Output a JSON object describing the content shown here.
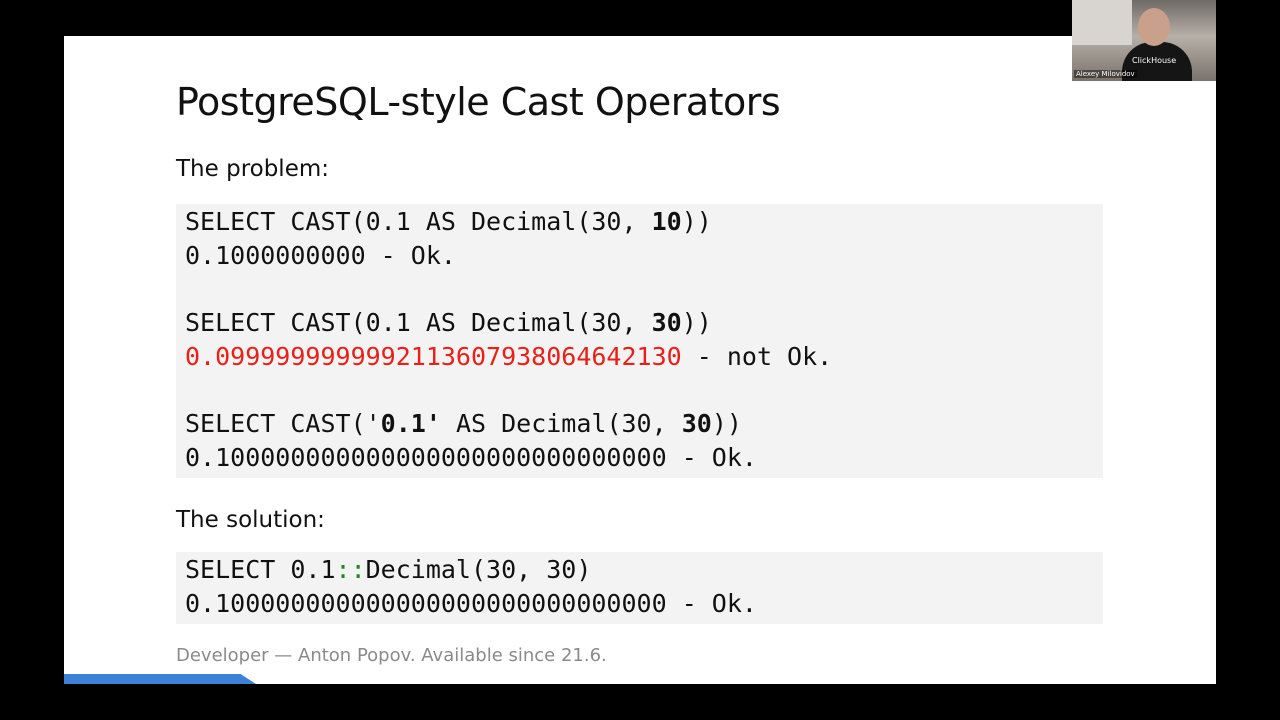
{
  "slide": {
    "title": "PostgreSQL-style Cast Operators",
    "problem_label": "The problem:",
    "solution_label": "The solution:",
    "footer": "Developer — Anton Popov. Available since 21.6."
  },
  "problem_code": [
    {
      "pre": "SELECT CAST(0.1 AS Decimal(30, ",
      "bold": "10",
      "post": "))"
    },
    {
      "text": "0.1000000000 - Ok."
    },
    {
      "text": ""
    },
    {
      "pre": "SELECT CAST(0.1 AS Decimal(30, ",
      "bold": "30",
      "post": "))"
    },
    {
      "red": "0.0999999999992113607938064642130",
      "rest": " - not Ok."
    },
    {
      "text": ""
    },
    {
      "pre": "SELECT CAST('",
      "bold": "0.1'",
      "mid": " AS Decimal(30, ",
      "bold2": "30",
      "post": "))"
    },
    {
      "text": "0.100000000000000000000000000000 - Ok."
    }
  ],
  "solution_code": [
    {
      "pre": "SELECT 0.1",
      "op": "::",
      "post": "Decimal(30, 30)"
    },
    {
      "text": "0.100000000000000000000000000000 - Ok."
    }
  ],
  "webcam": {
    "shirt_text": "ClickHouse",
    "presenter_name": "Alexey Milovidov"
  },
  "colors": {
    "accent_bar": "#3b82d6",
    "error_text": "#e8201a",
    "operator_text": "#1e8a1e",
    "code_background": "#f3f3f3"
  }
}
